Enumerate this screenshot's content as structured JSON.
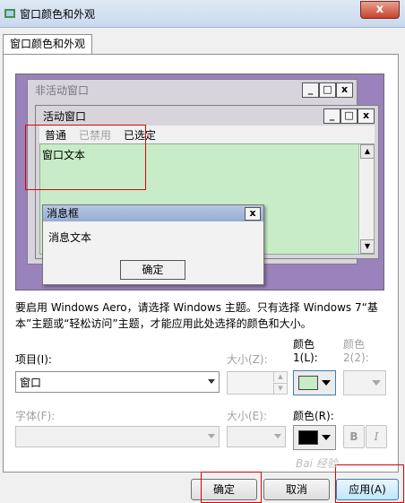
{
  "window": {
    "title": "窗口颜色和外观",
    "close_glyph": "x"
  },
  "tabs": [
    {
      "label": "窗口颜色和外观"
    }
  ],
  "preview": {
    "inactive_title": "非活动窗口",
    "active_title": "活动窗口",
    "menu": {
      "normal": "普通",
      "disabled": "已禁用",
      "selected": "已选定"
    },
    "window_text": "窗口文本",
    "message_box": {
      "title": "消息框",
      "text": "消息文本",
      "ok": "确定",
      "close_glyph": "x"
    },
    "controls": {
      "minimize": "_",
      "maximize": "□",
      "close": "x"
    },
    "scroll_up": "▲",
    "scroll_down": "▼"
  },
  "description": "要启用 Windows Aero，请选择 Windows 主题。只有选择 Windows 7“基本”主题或“轻松访问”主题，才能应用此处选择的颜色和大小。",
  "form": {
    "item_label": "项目(I):",
    "item_value": "窗口",
    "size1_label": "大小(Z):",
    "color1_label_a": "颜色",
    "color1_label_b": "1(L):",
    "color2_label_a": "颜色",
    "color2_label_b": "2(2):",
    "font_label": "字体(F):",
    "size2_label": "大小(E):",
    "color3_label": "颜色(R):",
    "bold": "B",
    "italic": "I"
  },
  "colors": {
    "color1": "#c8ecc8",
    "font_color": "#000000",
    "highlight": "#e00000"
  },
  "buttons": {
    "ok": "确定",
    "cancel": "取消",
    "apply": "应用(A)"
  },
  "watermark": "Bai 经验"
}
